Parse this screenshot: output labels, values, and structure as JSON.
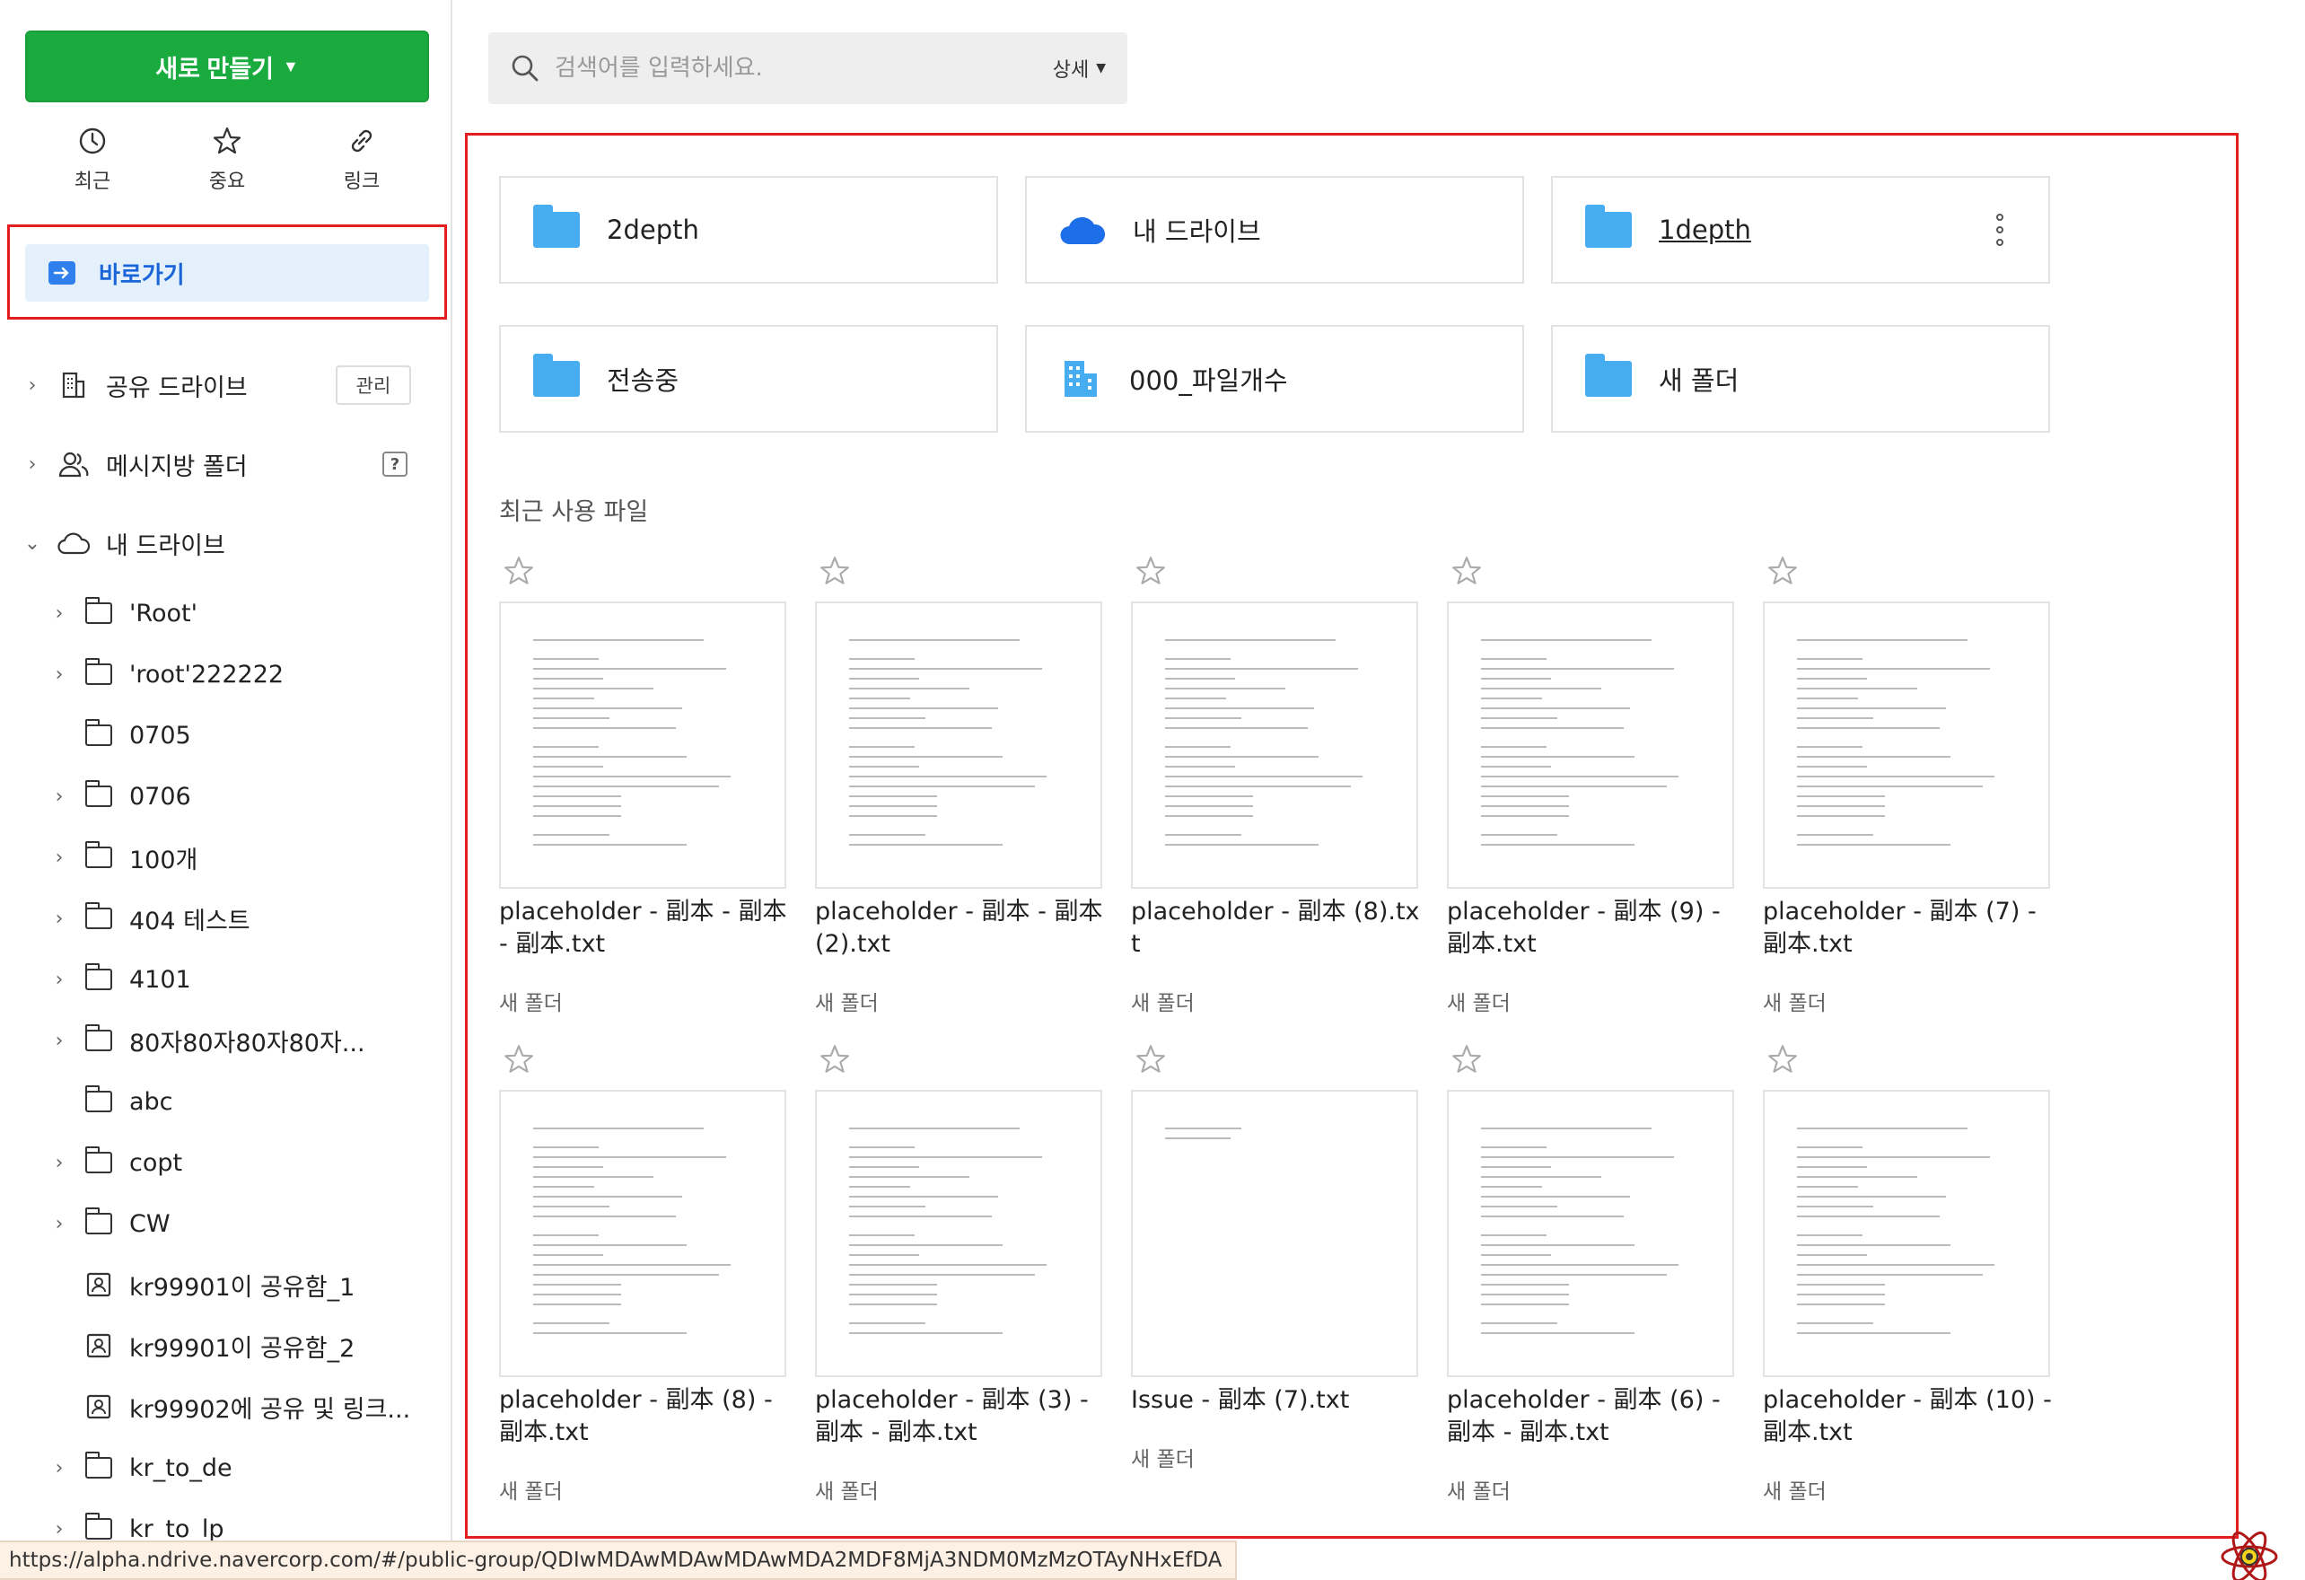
{
  "sidebar": {
    "new_button": "새로 만들기",
    "quick": [
      {
        "label": "최근",
        "icon": "clock-icon"
      },
      {
        "label": "중요",
        "icon": "star-icon"
      },
      {
        "label": "링크",
        "icon": "link-icon"
      }
    ],
    "goto_label": "바로가기",
    "shared_drive": {
      "label": "공유 드라이브",
      "manage": "관리"
    },
    "messenger_folder": {
      "label": "메시지방 폴더",
      "help": "?"
    },
    "my_drive": "내 드라이브",
    "tree_items": [
      {
        "label": "'Root'",
        "expandable": true,
        "icon": "folder-icon"
      },
      {
        "label": "'root'222222",
        "expandable": true,
        "icon": "folder-icon"
      },
      {
        "label": "0705",
        "expandable": false,
        "icon": "folder-icon"
      },
      {
        "label": "0706",
        "expandable": true,
        "icon": "folder-icon"
      },
      {
        "label": "100개",
        "expandable": true,
        "icon": "folder-icon"
      },
      {
        "label": "404 테스트",
        "expandable": true,
        "icon": "folder-icon"
      },
      {
        "label": "4101",
        "expandable": true,
        "icon": "folder-icon"
      },
      {
        "label": "80자80자80자80자...",
        "expandable": true,
        "icon": "folder-icon"
      },
      {
        "label": "abc",
        "expandable": false,
        "icon": "folder-icon"
      },
      {
        "label": "copt",
        "expandable": true,
        "icon": "folder-icon"
      },
      {
        "label": "CW",
        "expandable": true,
        "icon": "folder-icon"
      },
      {
        "label": "kr99901이 공유함_1",
        "expandable": false,
        "icon": "shared-folder-icon"
      },
      {
        "label": "kr99901이 공유함_2",
        "expandable": false,
        "icon": "shared-folder-icon"
      },
      {
        "label": "kr99902에 공유 및 링크...",
        "expandable": false,
        "icon": "shared-folder-icon"
      },
      {
        "label": "kr_to_de",
        "expandable": true,
        "icon": "folder-icon"
      },
      {
        "label": "kr_to_lp",
        "expandable": true,
        "icon": "folder-icon"
      }
    ]
  },
  "search": {
    "placeholder": "검색어를 입력하세요.",
    "detail": "상세"
  },
  "quick_access": [
    {
      "label": "2depth",
      "icon": "folder-icon",
      "underline": false
    },
    {
      "label": "내 드라이브",
      "icon": "cloud-icon",
      "underline": false
    },
    {
      "label": "1depth",
      "icon": "folder-icon",
      "underline": true
    },
    {
      "label": "전송중",
      "icon": "folder-icon",
      "underline": false
    },
    {
      "label": "000_파일개수",
      "icon": "building-icon",
      "underline": false
    },
    {
      "label": "새 폴더",
      "icon": "folder-icon",
      "underline": false
    }
  ],
  "recent_title": "최근 사용 파일",
  "recent_files": [
    {
      "name": "placeholder - 副本 - 副本 - 副本.txt",
      "location": "새 폴더"
    },
    {
      "name": "placeholder - 副本 - 副本 (2).txt",
      "location": "새 폴더"
    },
    {
      "name": "placeholder - 副本 (8).txt",
      "location": "새 폴더"
    },
    {
      "name": "placeholder - 副本 (9) - 副本.txt",
      "location": "새 폴더"
    },
    {
      "name": "placeholder - 副本 (7) - 副本.txt",
      "location": "새 폴더"
    },
    {
      "name": "placeholder - 副本 (8) - 副本.txt",
      "location": "새 폴더"
    },
    {
      "name": "placeholder - 副本 (3) - 副本 - 副本.txt",
      "location": "새 폴더"
    },
    {
      "name": "Issue - 副本 (7).txt",
      "location": "새 폴더"
    },
    {
      "name": "placeholder - 副本 (6) - 副本 - 副本.txt",
      "location": "새 폴더"
    },
    {
      "name": "placeholder - 副本 (10) - 副本.txt",
      "location": "새 폴더"
    }
  ],
  "status_url": "https://alpha.ndrive.navercorp.com/#/public-group/QDIwMDAwMDAwMDAwMDA2MDF8MjA3NDM0MzMzOTAyNHxEfDA",
  "colors": {
    "brand_green": "#1aab3f",
    "highlight_red": "#e41e1e",
    "folder_blue": "#46aef0",
    "goto_bg": "#e5f0fd"
  }
}
